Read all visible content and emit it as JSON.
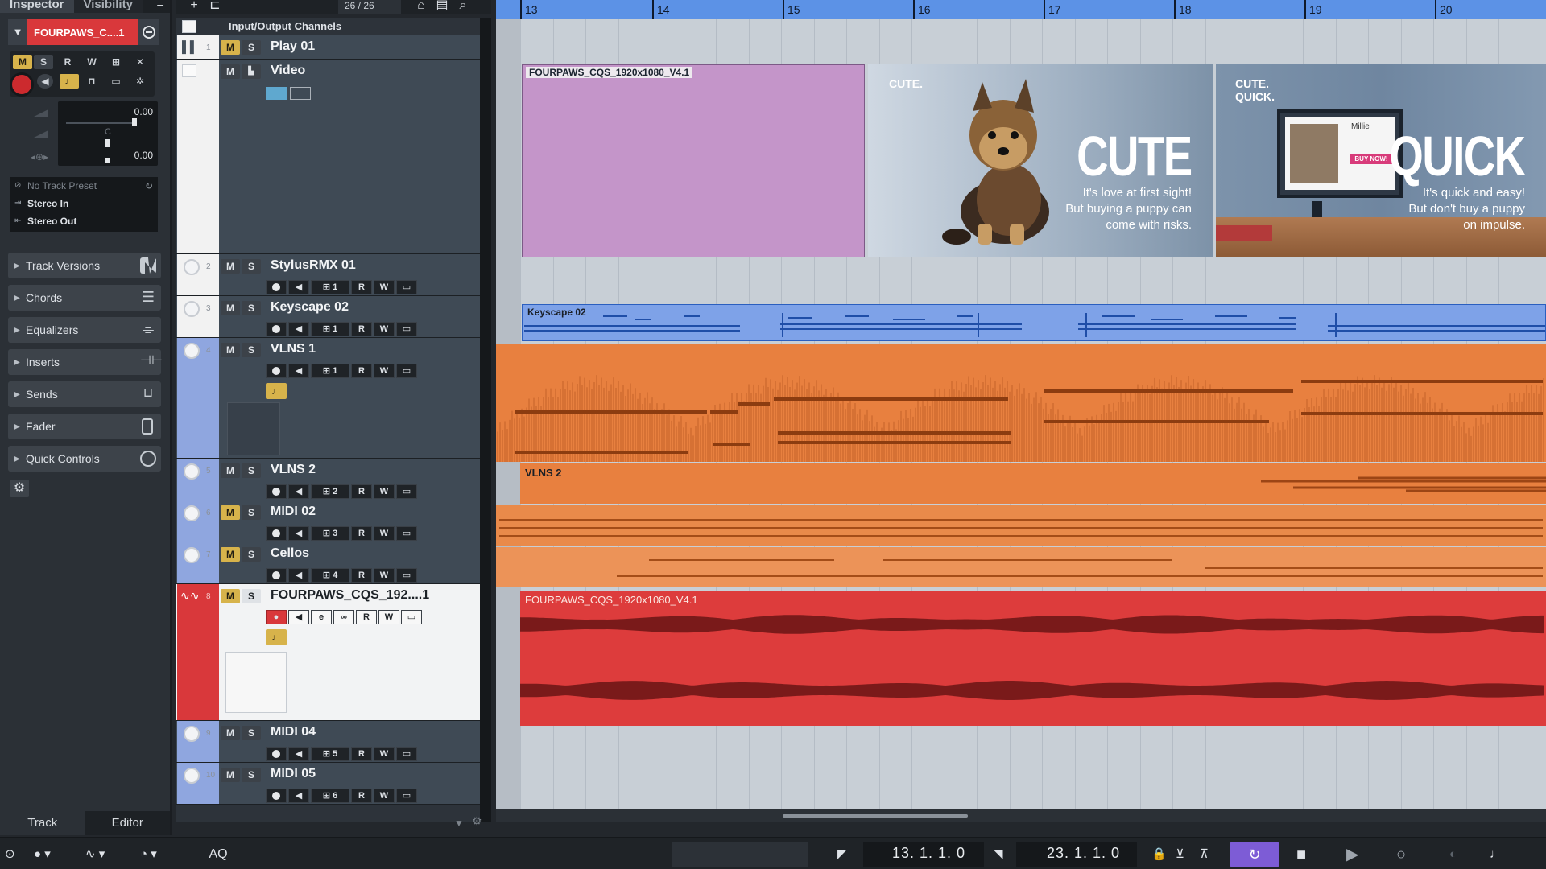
{
  "inspector": {
    "tabs": [
      "Inspector",
      "Visibility"
    ],
    "track_name": "FOURPAWS_C....1",
    "buttons": [
      "M",
      "S",
      "R",
      "W"
    ],
    "volume": "0.00",
    "pan": "C",
    "pan_value": "0.00",
    "preset": "No Track Preset",
    "input": "Stereo In",
    "output": "Stereo Out",
    "sections": [
      "Track Versions",
      "Chords",
      "Equalizers",
      "Inserts",
      "Sends",
      "Fader",
      "Quick Controls"
    ],
    "bottom_tabs": [
      "Track",
      "Editor"
    ]
  },
  "toolbar": {
    "track_count": "26 / 26"
  },
  "tracklist": {
    "folder_label": "Input/Output Channels",
    "tracks": [
      {
        "num": "1",
        "name": "Play 01"
      },
      {
        "num": "",
        "name": "Video"
      },
      {
        "num": "2",
        "name": "StylusRMX 01",
        "channel": "1"
      },
      {
        "num": "3",
        "name": "Keyscape 02",
        "channel": "1"
      },
      {
        "num": "4",
        "name": "VLNS 1",
        "channel": "1"
      },
      {
        "num": "5",
        "name": "VLNS 2",
        "channel": "2"
      },
      {
        "num": "6",
        "name": "MIDI 02",
        "channel": "3"
      },
      {
        "num": "7",
        "name": "Cellos",
        "channel": "4"
      },
      {
        "num": "8",
        "name": "FOURPAWS_CQS_192....1"
      },
      {
        "num": "9",
        "name": "MIDI 04",
        "channel": "5"
      },
      {
        "num": "10",
        "name": "MIDI 05",
        "channel": "6"
      }
    ]
  },
  "ruler": {
    "bars": [
      "13",
      "14",
      "15",
      "16",
      "17",
      "18",
      "19",
      "20"
    ]
  },
  "events": {
    "video_label": "FOURPAWS_CQS_1920x1080_V4.1",
    "frame1": {
      "small": "CUTE.",
      "big": "CUTE",
      "line1": "It's love at first sight!",
      "line2": "But buying a puppy can",
      "line3": "come with risks."
    },
    "frame2": {
      "small1": "CUTE.",
      "small2": "QUICK.",
      "big": "QUICK",
      "line1": "It's quick and easy!",
      "line2": "But don't buy a puppy",
      "line3": "on impulse.",
      "screen_title": "Millie",
      "screen_button": "BUY NOW!"
    },
    "keyscape_label": "Keyscape 02",
    "vlns2_label": "VLNS 2",
    "audio_label": "FOURPAWS_CQS_1920x1080_V4.1"
  },
  "transport": {
    "left_locator": "13. 1. 1.   0",
    "right_locator": "23. 1. 1.   0",
    "aq": "AQ"
  },
  "colors": {
    "ruler": "#5c92e6",
    "midi_event": "#7ea2e8",
    "audio_orange": "#e8803f",
    "audio_red": "#dd3c3c",
    "video_purple": "#c495c9",
    "mute_yellow": "#d7b34b",
    "cycle": "#7d5cd6"
  }
}
